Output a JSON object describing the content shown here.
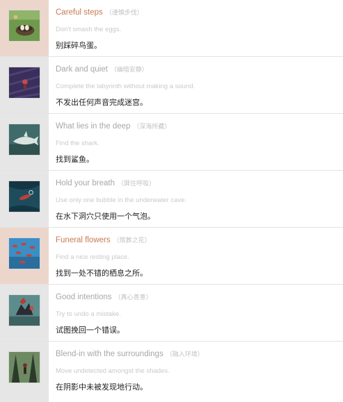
{
  "achievements": [
    {
      "title": "Careful steps",
      "title_cn": "（谨慎步伐）",
      "description": "Don't smash the eggs.",
      "description_cn": "别踩碎鸟蛋。",
      "highlighted": true,
      "icon": "bird-nest-icon",
      "thumb_color": "#6f9a4e"
    },
    {
      "title": "Dark and quiet",
      "title_cn": "（幽暗安静）",
      "description": "Complete the labyrinth without making a sound.",
      "description_cn": "不发出任何声音完成迷宫。",
      "highlighted": false,
      "icon": "labyrinth-icon",
      "thumb_color": "#3a2f5a"
    },
    {
      "title": "What lies in the deep",
      "title_cn": "（深海所藏）",
      "description": "Find the shark.",
      "description_cn": "找到鲨鱼。",
      "highlighted": false,
      "icon": "shark-icon",
      "thumb_color": "#3f6b6a"
    },
    {
      "title": "Hold your breath",
      "title_cn": "（屏住呼吸）",
      "description": "Use only one bubble in the underwater cave.",
      "description_cn": "在水下洞穴只使用一个气泡。",
      "highlighted": false,
      "icon": "underwater-cave-icon",
      "thumb_color": "#1f4c5c"
    },
    {
      "title": "Funeral flowers",
      "title_cn": "（殡葬之花）",
      "description": "Find a nice resting place.",
      "description_cn": "找到一处不错的栖息之所。",
      "highlighted": true,
      "icon": "flowers-icon",
      "thumb_color": "#3c8ec4"
    },
    {
      "title": "Good intentions",
      "title_cn": "（真心善意）",
      "description": "Try to undo a mistake.",
      "description_cn": "试图挽回一个错误。",
      "highlighted": false,
      "icon": "good-intentions-icon",
      "thumb_color": "#5d8c8c"
    },
    {
      "title": "Blend-in with the surroundings",
      "title_cn": "（融入环境）",
      "description": "Move undetected amongst the shades.",
      "description_cn": "在阴影中未被发现地行动。",
      "highlighted": false,
      "icon": "shades-icon",
      "thumb_color": "#4f6e55"
    }
  ],
  "colors": {
    "highlight_bg": "#ecd6cc",
    "normal_bg": "#e6e6e6",
    "highlight_title": "#c77a55"
  }
}
